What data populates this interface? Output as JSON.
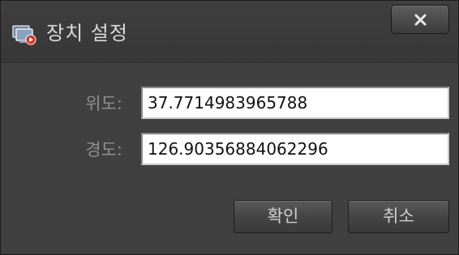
{
  "window": {
    "title": "장치 설정",
    "app_icon": "device-settings-icon",
    "close_icon": "close-icon"
  },
  "form": {
    "latitude": {
      "label": "위도:",
      "value": "37.7714983965788"
    },
    "longitude": {
      "label": "경도:",
      "value": "126.90356884062296"
    }
  },
  "buttons": {
    "ok_label": "확인",
    "cancel_label": "취소"
  },
  "colors": {
    "background": "#404040",
    "label_text": "#909090",
    "button_text": "#cfcfcf",
    "icon_red": "#e0301e"
  }
}
